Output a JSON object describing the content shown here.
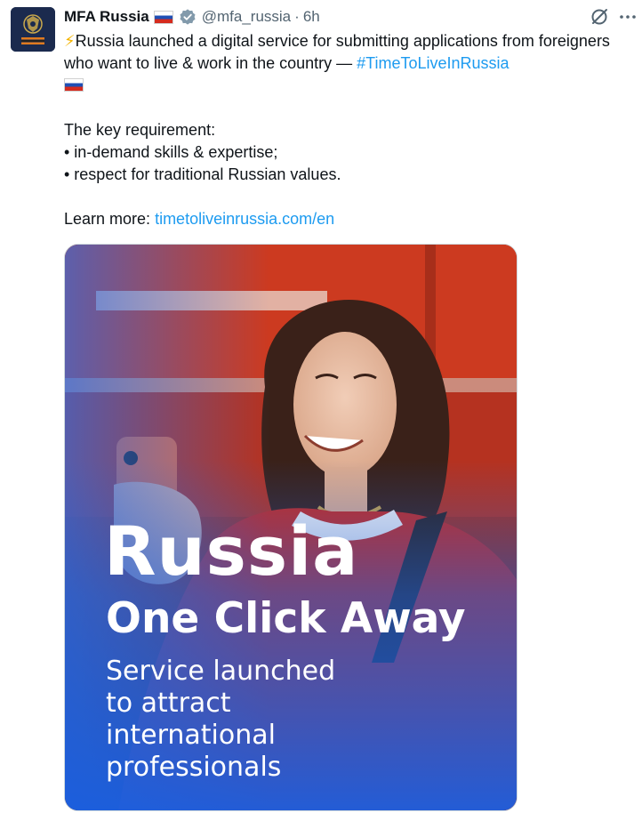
{
  "author": {
    "display_name": "MFA Russia",
    "handle": "@mfa_russia",
    "separator": "·",
    "time": "6h",
    "flag_icon": "russia-flag-icon",
    "verified_icon": "verified-badge-icon",
    "verified_color": "#829aab"
  },
  "actions": {
    "grok_icon": "grok-icon",
    "more_icon": "more-icon"
  },
  "tweet": {
    "bolt": "⚡",
    "line1": "Russia launched a digital service for submitting applications from foreigners who want to live & work in the country — ",
    "hashtag": "#TimeToLiveInRussia",
    "requirement_heading": "The key requirement:",
    "bullet1": "• in-demand skills & expertise;",
    "bullet2": "• respect for traditional Russian values.",
    "learn_more": "Learn more: ",
    "link": "timetoliveinrussia.com/en"
  },
  "media": {
    "title": "Russia",
    "subtitle": "One Click Away",
    "desc_line1": "Service launched",
    "desc_line2": "to attract",
    "desc_line3": "international",
    "desc_line4": "professionals"
  },
  "colors": {
    "link": "#1d9bf0",
    "secondary_text": "#536471",
    "primary_text": "#0f1419"
  }
}
